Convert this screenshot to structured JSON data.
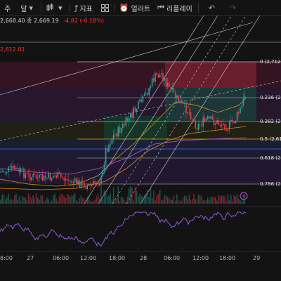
{
  "toolbar": {
    "items": [
      {
        "label": "주",
        "icon": "none"
      },
      {
        "label": "달",
        "icon": "chevron-down-icon"
      },
      {
        "label": "",
        "icon": "candles-icon"
      },
      {
        "label": "",
        "icon": "chevron-down-icon"
      },
      {
        "label": "지표",
        "icon": "indicator-icon"
      },
      {
        "label": "",
        "icon": "grid-icon"
      },
      {
        "label": "얼러트",
        "icon": "alarm-clock-icon"
      },
      {
        "label": "리플레이",
        "icon": "replay-icon"
      }
    ],
    "undo_icon": "undo-icon",
    "redo_icon": "redo-icon"
  },
  "legend": {
    "ohlc_text": "2,668.40 종 2,669.19",
    "change_text": "-4.82 (-0.18%)",
    "ma_value": "2,612.01"
  },
  "fib_levels": [
    {
      "ratio": "0",
      "label": "0 (2,712.25)"
    },
    {
      "ratio": "0.236",
      "label": "0.236 (2,66"
    },
    {
      "ratio": "0.382",
      "label": "0.382 (2,63"
    },
    {
      "ratio": "0.5",
      "label": "0.5 (2,610."
    },
    {
      "ratio": "0.618",
      "label": "0.618 (2,59"
    },
    {
      "ratio": "0.786",
      "label": "0.786 (2,55"
    }
  ],
  "x_axis": [
    "8:00",
    "27",
    "06:00",
    "12:00",
    "18:00",
    "28",
    "06:00",
    "12:00",
    "18:00",
    "29"
  ],
  "colors": {
    "up": "#26a69a",
    "down": "#f23645",
    "background": "#131313"
  }
}
